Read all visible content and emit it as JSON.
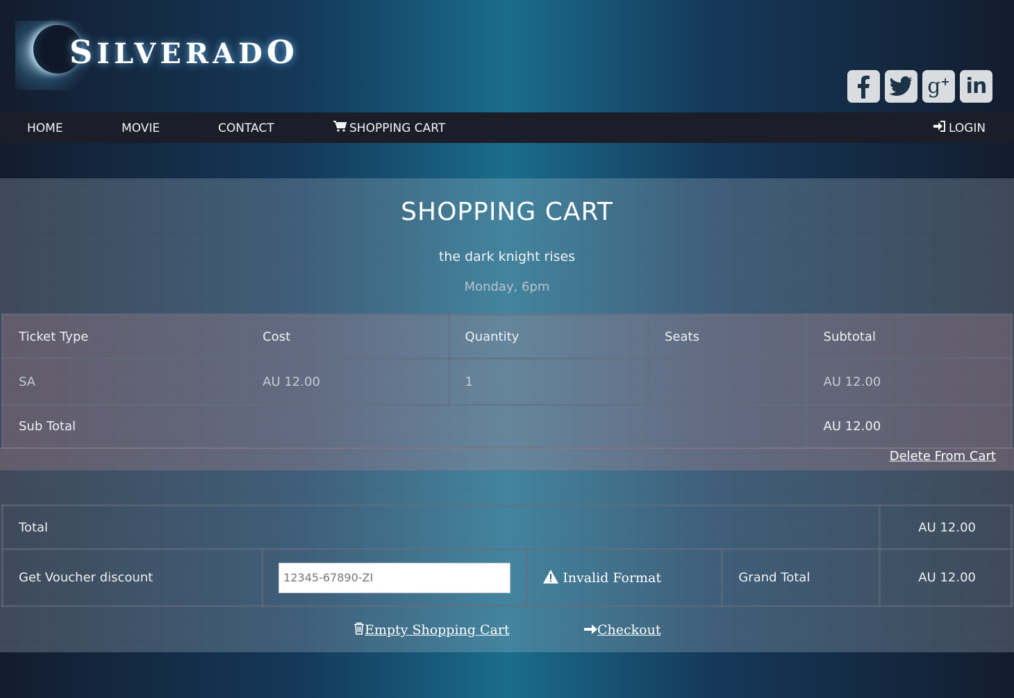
{
  "brand": {
    "name": "SILVERADO",
    "first": "S",
    "rest": "ILVERAD",
    "last": "O"
  },
  "social": [
    {
      "icon": "facebook-icon",
      "glyph": "f"
    },
    {
      "icon": "twitter-icon",
      "glyph": "t"
    },
    {
      "icon": "google-plus-icon",
      "glyph": "g+"
    },
    {
      "icon": "linkedin-icon",
      "glyph": "in"
    }
  ],
  "nav": {
    "home": "HOME",
    "movie": "MOVIE",
    "contact": "CONTACT",
    "cart": "SHOPPING CART",
    "cart_icon": "cart-icon",
    "login": "LOGIN",
    "login_icon": "login-icon"
  },
  "cart": {
    "title": "SHOPPING CART",
    "movie": "the dark knight rises",
    "session": "Monday, 6pm",
    "headers": [
      "Ticket Type",
      "Cost",
      "Quantity",
      "Seats",
      "Subtotal"
    ],
    "rows": [
      {
        "type": "SA",
        "cost": "AU 12.00",
        "quantity": "1",
        "seats": "",
        "subtotal": "AU 12.00"
      }
    ],
    "subtotal_label": "Sub Total",
    "subtotal_value": "AU 12.00",
    "delete_label": "Delete From Cart"
  },
  "summary": {
    "total_label": "Total",
    "total_value": "AU 12.00",
    "voucher_label": "Get Voucher discount",
    "voucher_placeholder": "12345-67890-ZI",
    "voucher_value": "",
    "invalid_message": "Invalid Format",
    "warning_icon": "warning-icon",
    "grand_total_label": "Grand Total",
    "grand_total_value": "AU 12.00"
  },
  "actions": {
    "empty_label": "Empty Shopping Cart",
    "empty_icon": "trash-icon",
    "checkout_label": "Checkout",
    "checkout_icon": "arrow-right-icon"
  }
}
